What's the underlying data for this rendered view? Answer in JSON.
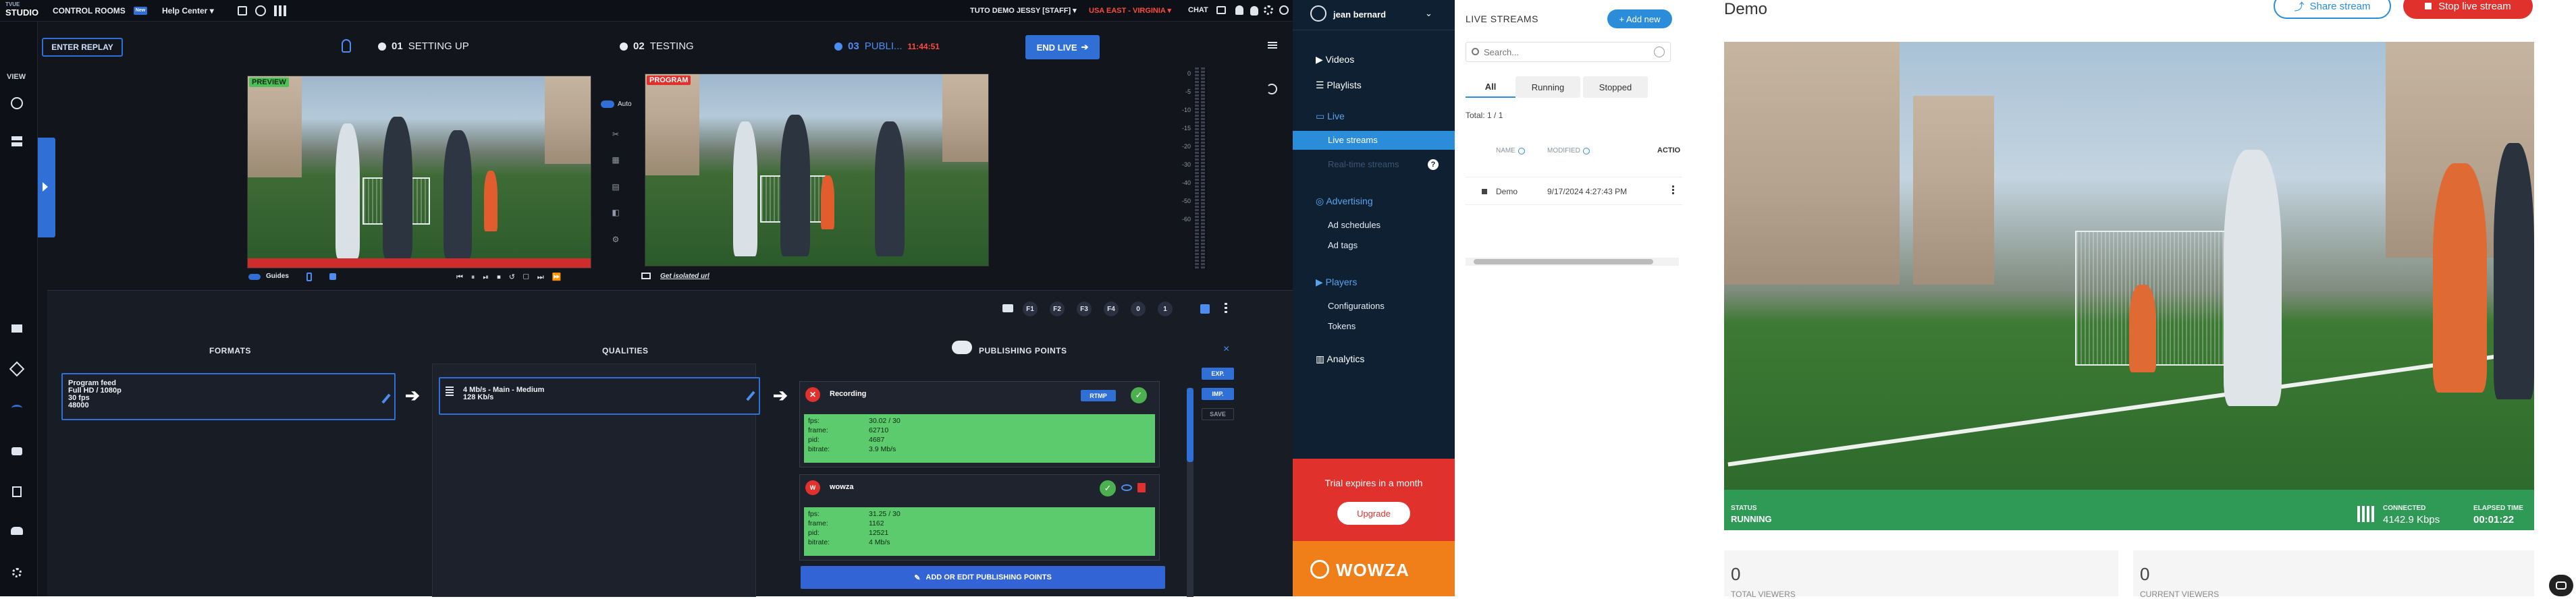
{
  "studio": {
    "logo_top": "TVUE",
    "logo_bottom": "STUDIO",
    "nav": {
      "control_rooms": "CONTROL ROOMS",
      "help_center": "Help Center",
      "badge": "New"
    },
    "right": {
      "tuto": "TUTO DEMO JESSY [STAFF]",
      "region": "USA EAST - VIRGINIA",
      "chat": "CHAT"
    },
    "view_label": "VIEW",
    "enter_replay": "ENTER REPLAY",
    "steps": [
      {
        "num": "01",
        "label": "SETTING UP"
      },
      {
        "num": "02",
        "label": "TESTING"
      },
      {
        "num": "03",
        "label": "PUBLI...",
        "time": "11:44:51"
      }
    ],
    "end_live": "END LIVE",
    "preview_label": "PREVIEW",
    "program_label": "PROGRAM",
    "auto_label": "Auto",
    "guides_label": "Guides",
    "isolated_label": "Get isolated url",
    "meter_scale": [
      "0",
      "-5",
      "-10",
      "-15",
      "-20",
      "-30",
      "-40",
      "-50",
      "-60"
    ],
    "ctrl": {
      "f1": "F1",
      "f2": "F2",
      "f3": "F3",
      "f4": "F4",
      "zero": "0",
      "one": "1"
    },
    "columns": {
      "formats": "FORMATS",
      "qualities": "QUALITIES",
      "publishing": "PUBLISHING POINTS"
    },
    "format_card": {
      "line1": "Program feed",
      "line2": "Full HD / 1080p",
      "line3": "30 fps",
      "line4": "48000"
    },
    "quality_card": {
      "line1": "4 Mb/s  -  Main  -  Medium",
      "line2": "128 Kb/s"
    },
    "pub1": {
      "name": "Recording",
      "badge": "RTMP",
      "stats": [
        {
          "k": "fps:",
          "v": "30.02 / 30"
        },
        {
          "k": "frame:",
          "v": "62710"
        },
        {
          "k": "pid:",
          "v": "4687"
        },
        {
          "k": "bitrate:",
          "v": "3.9 Mb/s"
        }
      ]
    },
    "pub2": {
      "name": "wowza",
      "stats": [
        {
          "k": "fps:",
          "v": "31.25 / 30"
        },
        {
          "k": "frame:",
          "v": "1162"
        },
        {
          "k": "pid:",
          "v": "12521"
        },
        {
          "k": "bitrate:",
          "v": "4 Mb/s"
        }
      ]
    },
    "add_pub": "ADD OR EDIT PUBLISHING POINTS",
    "side_btns": {
      "exp": "EXP.",
      "imp": "IMP.",
      "save": "SAVE"
    }
  },
  "wowza_sidebar": {
    "user": "jean bernard",
    "videos": "Videos",
    "playlists": "Playlists",
    "live": "Live",
    "live_streams": "Live streams",
    "realtime": "Real-time streams",
    "advertising": "Advertising",
    "ad_schedules": "Ad schedules",
    "ad_tags": "Ad tags",
    "players": "Players",
    "configurations": "Configurations",
    "tokens": "Tokens",
    "analytics": "Analytics",
    "trial": "Trial expires in a month",
    "upgrade": "Upgrade",
    "brand": "WOWZA"
  },
  "live_streams": {
    "title": "LIVE STREAMS",
    "add_new": "+ Add new",
    "search_placeholder": "Search...",
    "tabs": [
      "All",
      "Running",
      "Stopped"
    ],
    "total": "Total: 1 / 1",
    "headers": {
      "name": "NAME",
      "modified": "MODIFIED",
      "actions": "ACTIO"
    },
    "rows": [
      {
        "name": "Demo",
        "modified": "9/17/2024 4:27:43 PM"
      }
    ]
  },
  "detail": {
    "title": "Demo",
    "share": "Share stream",
    "stop": "Stop live stream",
    "status_label": "STATUS",
    "status_value": "RUNNING",
    "connected_label": "CONNECTED",
    "connected_value": "4142.9 Kbps",
    "elapsed_label": "ELAPSED TIME",
    "elapsed_value": "00:01:22",
    "total_viewers_num": "0",
    "total_viewers_label": "TOTAL VIEWERS",
    "current_viewers_num": "0",
    "current_viewers_label": "CURRENT VIEWERS"
  },
  "colors": {
    "accent": "#2f6fd6",
    "live_red": "#e0312d",
    "status_green": "#2f9a56",
    "stat_green": "#5ccb6e",
    "wowza_orange": "#f07f1a"
  }
}
